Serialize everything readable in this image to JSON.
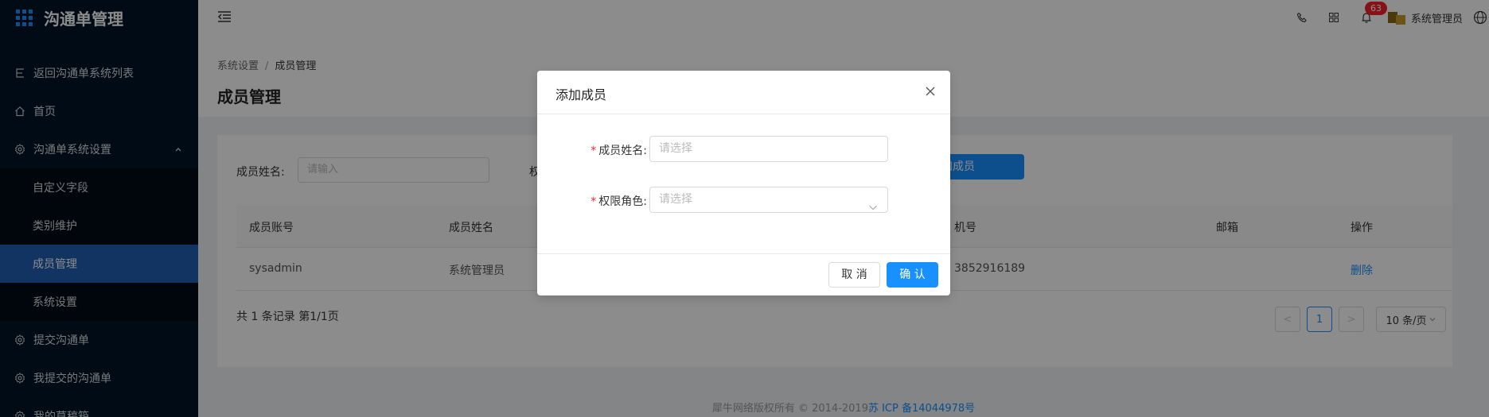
{
  "app": {
    "title": "沟通单管理"
  },
  "sidebar": {
    "items": [
      {
        "label": "返回沟通单系统列表",
        "icon": "back-icon"
      },
      {
        "label": "首页",
        "icon": "home-icon"
      },
      {
        "label": "沟通单系统设置",
        "icon": "gear-icon"
      },
      {
        "label": "提交沟通单",
        "icon": "gear-icon"
      },
      {
        "label": "我提交的沟通单",
        "icon": "gear-icon"
      },
      {
        "label": "我的草稿箱",
        "icon": "gear-icon"
      }
    ],
    "submenu": [
      {
        "label": "自定义字段"
      },
      {
        "label": "类别维护"
      },
      {
        "label": "成员管理",
        "active": true
      },
      {
        "label": "系统设置"
      }
    ]
  },
  "header": {
    "notification_count": "63",
    "user_name": "系统管理员"
  },
  "breadcrumb": {
    "parent": "系统设置",
    "separator": "/",
    "current": "成员管理"
  },
  "page_title": "成员管理",
  "filter": {
    "name_label": "成员姓名:",
    "name_placeholder": "请输入",
    "role_label": "权",
    "add_button": "加成员"
  },
  "table": {
    "columns": [
      "成员账号",
      "成员姓名",
      "机号",
      "邮箱",
      "操作"
    ],
    "rows": [
      {
        "account": "sysadmin",
        "name": "系统管理员",
        "phone": "3852916189",
        "email": "",
        "action": "删除"
      }
    ]
  },
  "pagination": {
    "summary": "共 1 条记录 第1/1页",
    "prev": "<",
    "current": "1",
    "next": ">",
    "page_size": "10 条/页"
  },
  "footer": {
    "copyright": "犀牛网络版权所有 © 2014-2019",
    "icp": "苏 ICP 备14044978号"
  },
  "modal": {
    "title": "添加成员",
    "fields": [
      {
        "label": "成员姓名:",
        "placeholder": "请选择",
        "required": true
      },
      {
        "label": "权限角色:",
        "placeholder": "请选择",
        "required": true
      }
    ],
    "cancel": "取 消",
    "ok": "确 认"
  },
  "colors": {
    "primary": "#1890ff",
    "sidebar": "#001529",
    "danger": "#f5222d"
  }
}
